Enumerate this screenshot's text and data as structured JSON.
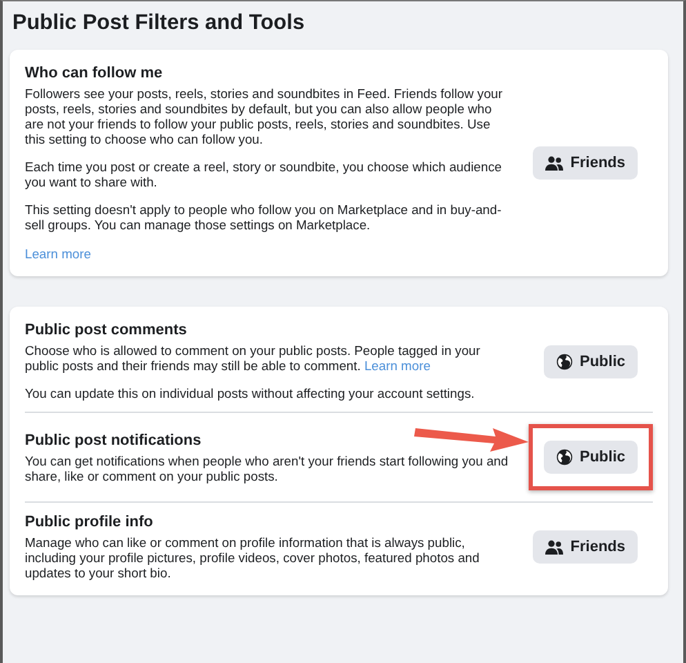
{
  "page_title": "Public Post Filters and Tools",
  "cards": [
    {
      "sections": [
        {
          "title": "Who can follow me",
          "paragraphs": [
            {
              "text": "Followers see your posts, reels, stories and soundbites in Feed. Friends follow your posts, reels, stories and soundbites by default, but you can also allow people who are not your friends to follow your public posts, reels, stories and soundbites. Use this setting to choose who can follow you."
            },
            {
              "text": "Each time you post or create a reel, story or soundbite, you choose which audience you want to share with."
            },
            {
              "text": "This setting doesn't apply to people who follow you on Marketplace and in buy-and-sell groups. You can manage those settings on Marketplace."
            },
            {
              "link": "Learn more"
            }
          ],
          "button": {
            "kind": "friends",
            "label": "Friends"
          },
          "highlighted": false
        }
      ]
    },
    {
      "sections": [
        {
          "title": "Public post comments",
          "paragraphs": [
            {
              "text": "Choose who is allowed to comment on your public posts. People tagged in your public posts and their friends may still be able to comment.",
              "link": "Learn more"
            },
            {
              "text": "You can update this on individual posts without affecting your account settings."
            }
          ],
          "button": {
            "kind": "globe",
            "label": "Public"
          },
          "highlighted": false
        },
        {
          "title": "Public post notifications",
          "paragraphs": [
            {
              "text": "You can get notifications when people who aren't your friends start following you and share, like or comment on your public posts."
            }
          ],
          "button": {
            "kind": "globe",
            "label": "Public"
          },
          "highlighted": true
        },
        {
          "title": "Public profile info",
          "paragraphs": [
            {
              "text": "Manage who can like or comment on profile information that is always public, including your profile pictures, profile videos, cover photos, featured photos and updates to your short bio."
            }
          ],
          "button": {
            "kind": "friends",
            "label": "Friends"
          },
          "highlighted": false
        }
      ]
    }
  ]
}
